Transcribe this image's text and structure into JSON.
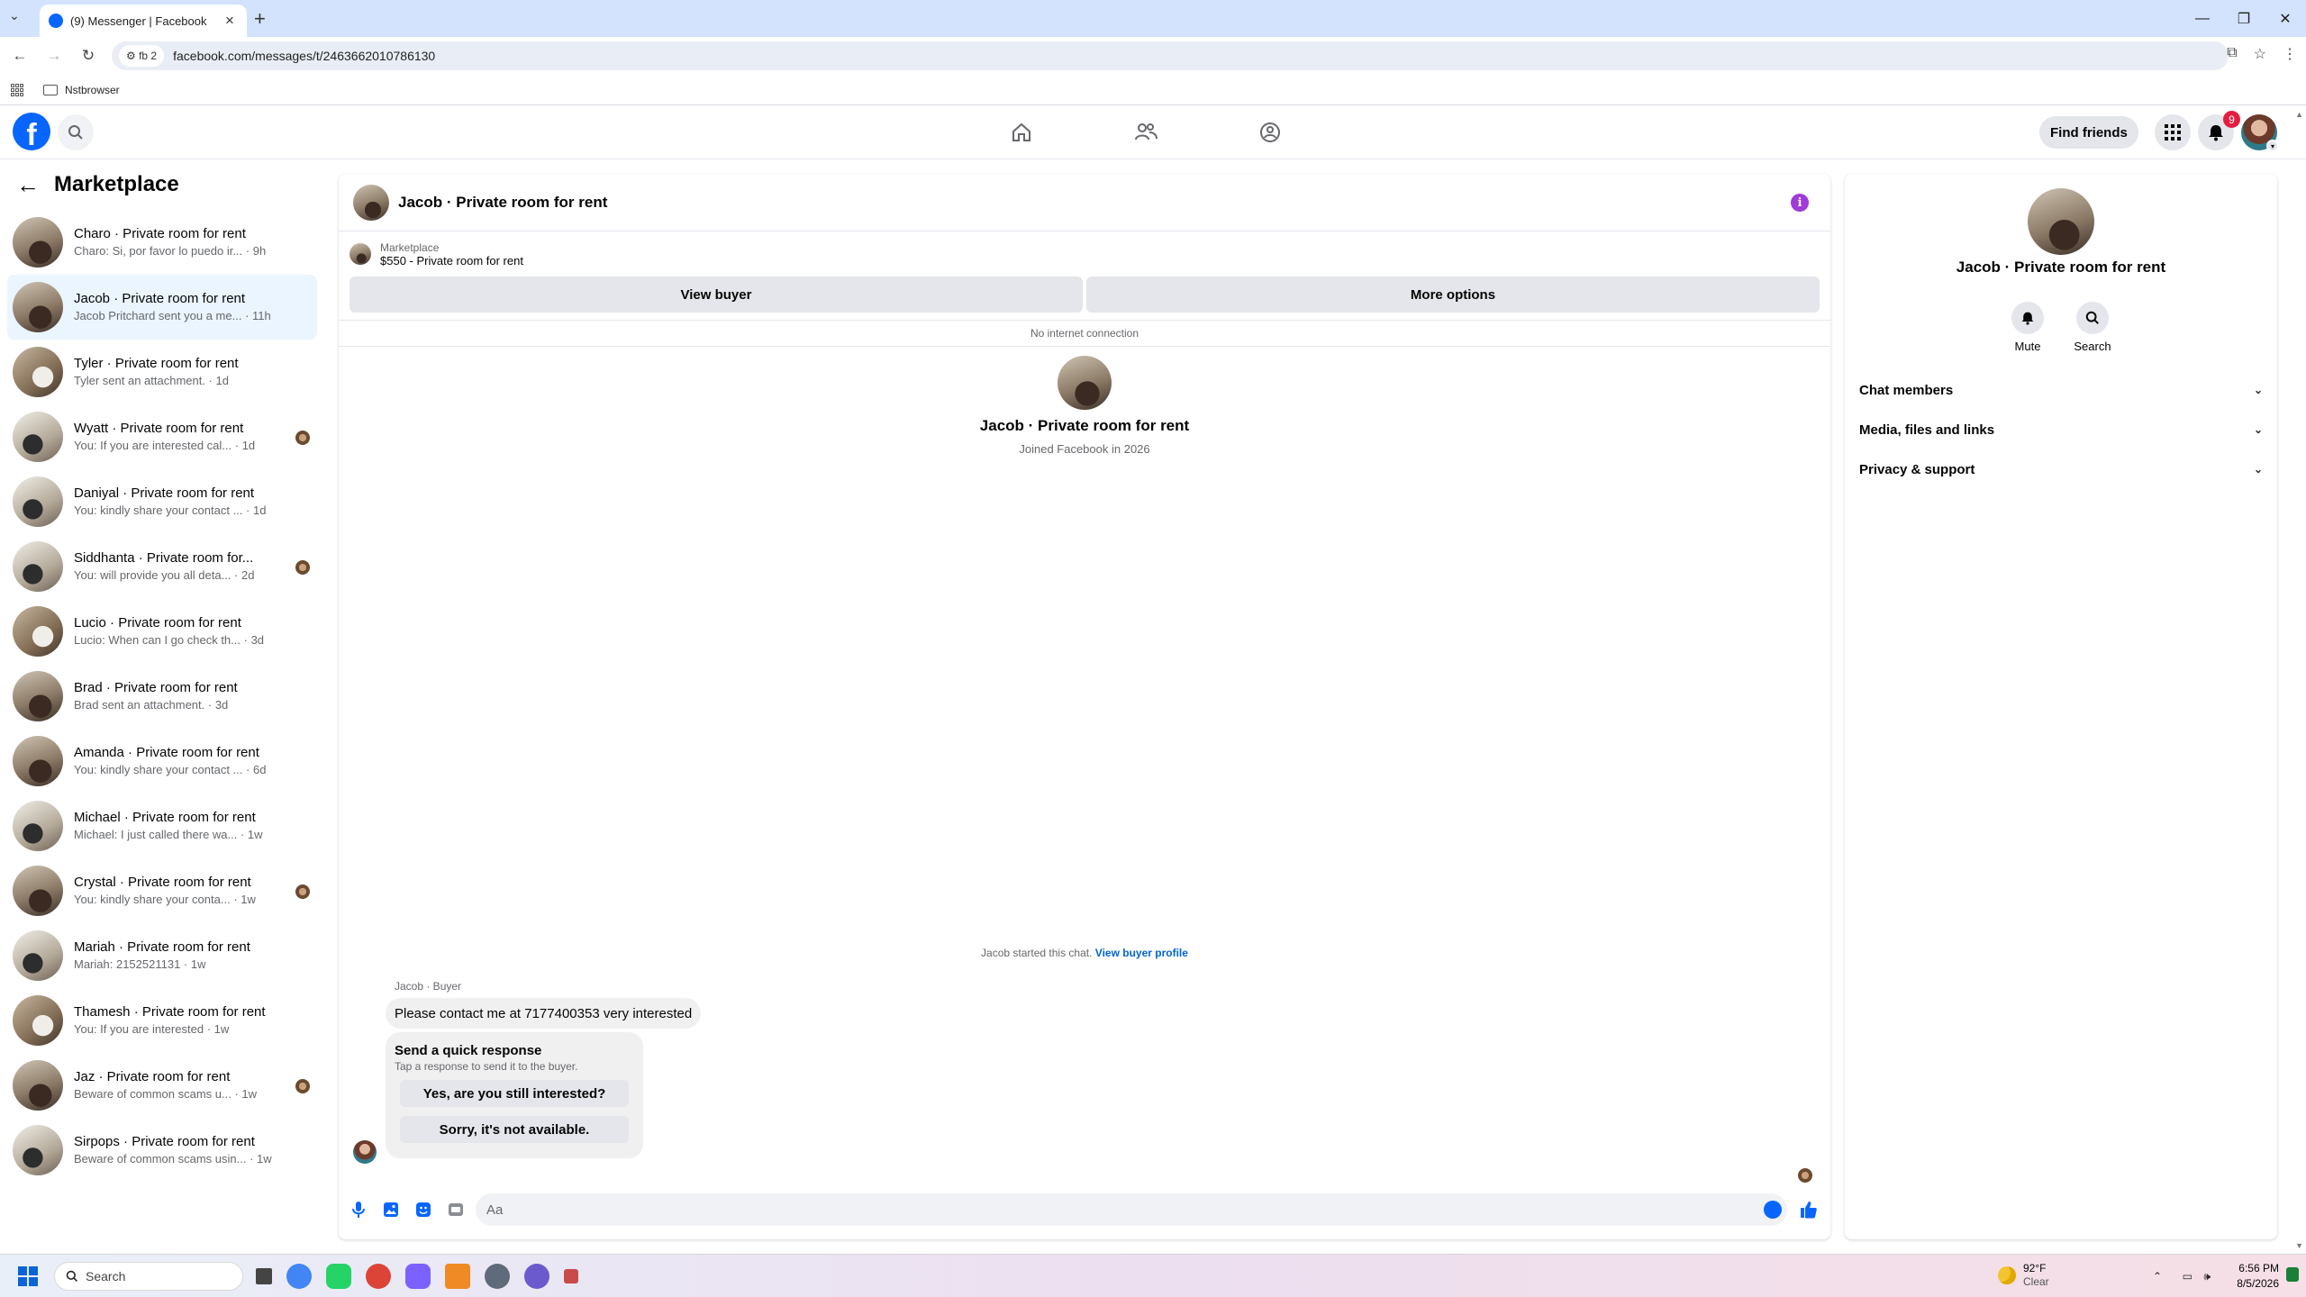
{
  "browser": {
    "tab_title": "(9) Messenger | Facebook",
    "url": "facebook.com/messages/t/2463662010786130",
    "profile_label": "fb 2",
    "bookmark_folder": "Nstbrowser"
  },
  "header": {
    "find_friends": "Find friends",
    "notification_count": "9"
  },
  "sidebar": {
    "title": "Marketplace",
    "conversations": [
      {
        "title": "Charo · Private room for rent",
        "preview": "Charo: Si, por favor lo puedo ir...",
        "time": "· 9h",
        "active": false
      },
      {
        "title": "Jacob · Private room for rent",
        "preview": "Jacob Pritchard sent you a me...",
        "time": "· 11h",
        "active": true
      },
      {
        "title": "Tyler · Private room for rent",
        "preview": "Tyler sent an attachment.",
        "time": "· 1d",
        "active": false
      },
      {
        "title": "Wyatt · Private room for rent",
        "preview": "You: If you are interested cal...",
        "time": "· 1d",
        "active": false
      },
      {
        "title": "Daniyal · Private room for rent",
        "preview": "You: kindly share your contact ...",
        "time": "· 1d",
        "active": false
      },
      {
        "title": "Siddhanta · Private room for...",
        "preview": "You: will provide you all deta...",
        "time": "· 2d",
        "active": false
      },
      {
        "title": "Lucio · Private room for rent",
        "preview": "Lucio: When can I go check th...",
        "time": "· 3d",
        "active": false
      },
      {
        "title": "Brad · Private room for rent",
        "preview": "Brad sent an attachment.",
        "time": "· 3d",
        "active": false
      },
      {
        "title": "Amanda · Private room for rent",
        "preview": "You: kindly share your contact ...",
        "time": "· 6d",
        "active": false
      },
      {
        "title": "Michael · Private room for rent",
        "preview": "Michael: I just called there wa...",
        "time": "· 1w",
        "active": false
      },
      {
        "title": "Crystal · Private room for rent",
        "preview": "You: kindly share your conta...",
        "time": "· 1w",
        "active": false
      },
      {
        "title": "Mariah · Private room for rent",
        "preview": "Mariah: 2152521131",
        "time": "· 1w",
        "active": false
      },
      {
        "title": "Thamesh · Private room for rent",
        "preview": "You: If you are interested",
        "time": "· 1w",
        "active": false
      },
      {
        "title": "Jaz · Private room for rent",
        "preview": "Beware of common scams u...",
        "time": "· 1w",
        "active": false
      },
      {
        "title": "Sirpops · Private room for rent",
        "preview": "Beware of common scams usin...",
        "time": "· 1w",
        "active": false
      }
    ]
  },
  "chat": {
    "title": "Jacob · Private room for rent",
    "listing_source": "Marketplace",
    "listing_title": "$550 - Private room for rent",
    "view_buyer": "View buyer",
    "more_options": "More options",
    "connection_status": "No internet connection",
    "intro_name": "Jacob · Private room for rent",
    "intro_joined": "Joined Facebook in 2026",
    "started_text": "Jacob started this chat.",
    "view_buyer_profile": "View buyer profile",
    "sender_label": "Jacob · Buyer",
    "message": "Please contact me at 7177400353 very interested",
    "quick_response_title": "Send a quick response",
    "quick_response_sub": "Tap a response to send it to the buyer.",
    "quick_options": [
      "Yes, are you still interested?",
      "Sorry, it's not available."
    ],
    "composer_placeholder": "Aa"
  },
  "details": {
    "name": "Jacob · Private room for rent",
    "mute": "Mute",
    "search": "Search",
    "sections": [
      "Chat members",
      "Media, files and links",
      "Privacy & support"
    ]
  },
  "taskbar": {
    "search_placeholder": "Search",
    "temperature": "92°F",
    "weather": "Clear",
    "time": "6:56 PM",
    "date": "8/5/2026"
  }
}
